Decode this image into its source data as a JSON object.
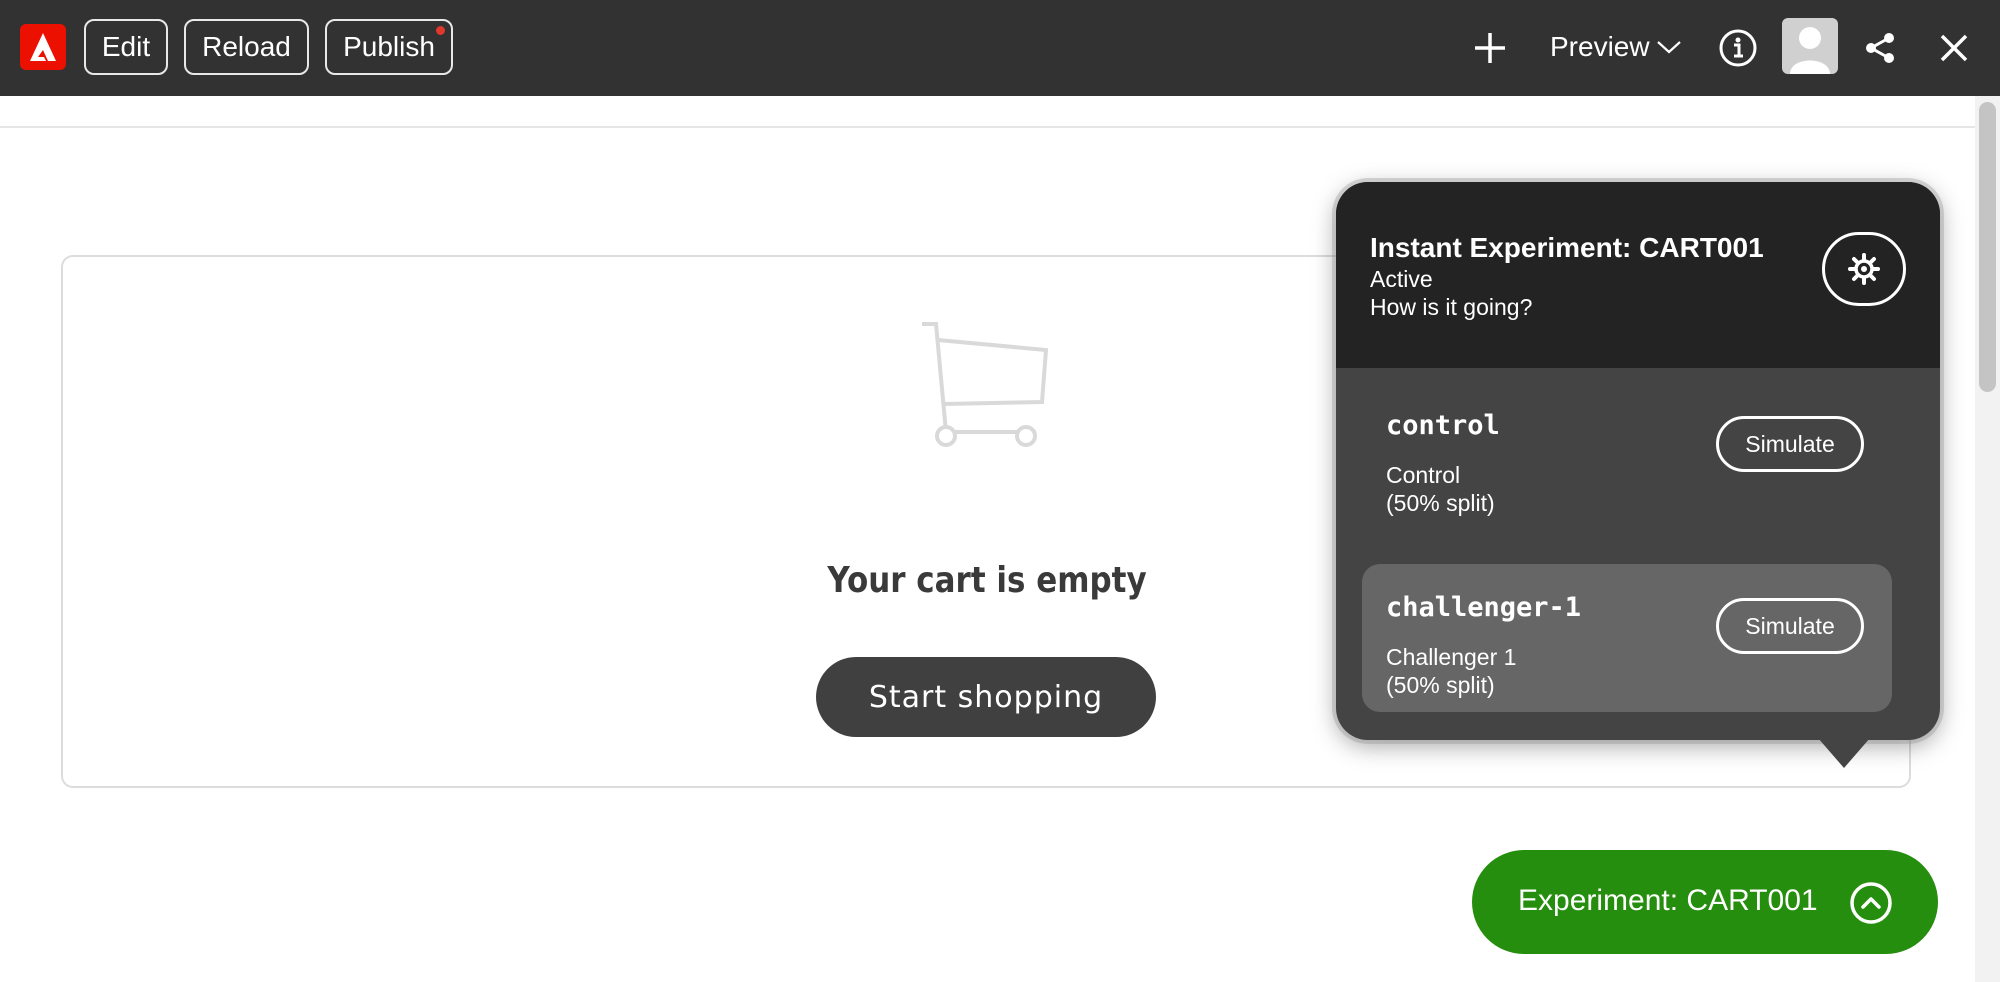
{
  "toolbar": {
    "logo_icon": "adobe-logo-icon",
    "edit_label": "Edit",
    "reload_label": "Reload",
    "publish_label": "Publish",
    "preview_label": "Preview",
    "icons": [
      "plus-icon",
      "chevron-down-icon",
      "info-icon",
      "avatar",
      "share-icon",
      "close-icon"
    ]
  },
  "cart": {
    "empty_message": "Your cart is empty",
    "start_button": "Start shopping",
    "icon": "shopping-cart-icon"
  },
  "experiment_popover": {
    "title": "Instant Experiment: CART001",
    "status": "Active",
    "question": "How is it going?",
    "settings_icon": "gear-icon",
    "variants": [
      {
        "id": "control",
        "name": "Control",
        "split": "(50% split)",
        "button": "Simulate"
      },
      {
        "id": "challenger-1",
        "name": "Challenger 1",
        "split": "(50% split)",
        "button": "Simulate"
      }
    ]
  },
  "experiment_pill": {
    "label": "Experiment: CART001",
    "icon": "chevron-up-circle-icon"
  },
  "colors": {
    "toolbar_bg": "#323232",
    "adobe_red": "#eb1000",
    "popover_bg": "#444444",
    "popover_header_bg": "#232323",
    "selected_variant_bg": "#666666",
    "experiment_green": "#268e0e",
    "start_button_bg": "#404040"
  }
}
